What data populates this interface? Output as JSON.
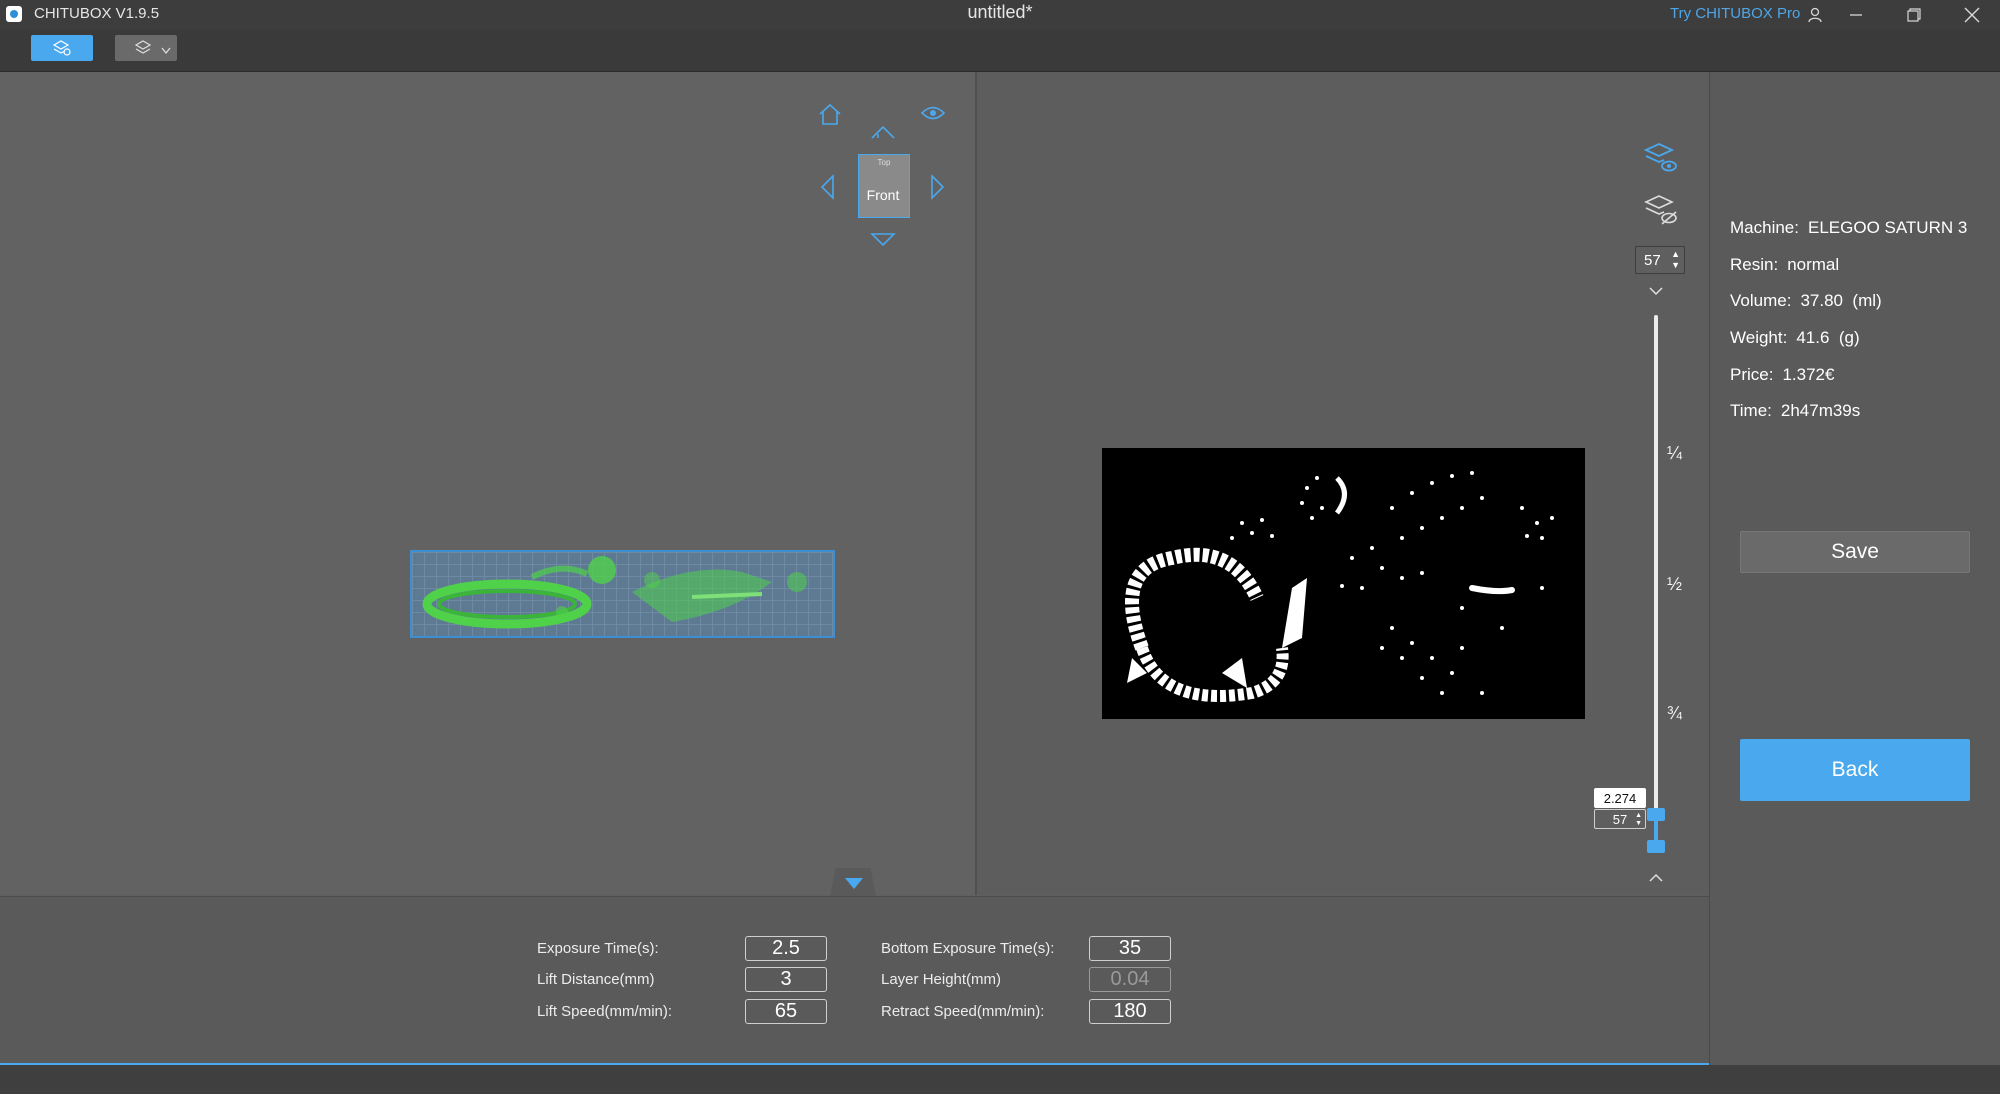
{
  "app": {
    "name": "CHITUBOX V1.9.5",
    "document_title": "untitled*",
    "try_pro_link": "Try CHITUBOX Pro"
  },
  "icons": {
    "app_logo": "app-logo-icon",
    "user": "user-icon",
    "minimize": "minimize-icon",
    "maximize": "restore-icon",
    "close": "close-icon",
    "slice_mode": "slice-layers-icon",
    "edit_mode": "edit-layers-icon",
    "home_view": "home-icon",
    "visibility": "eye-icon",
    "show_layers": "layers-eye-icon",
    "hide_layers": "layers-hidden-icon"
  },
  "view_cube": {
    "top_face": "Top",
    "front_face": "Front"
  },
  "layer_slider": {
    "top_layer": "57",
    "fractions": [
      "¼",
      "½",
      "¾"
    ],
    "current_height": "2.274",
    "current_layer": "57"
  },
  "parameters": {
    "left": [
      {
        "label": "Exposure Time(s):",
        "value": "2.5"
      },
      {
        "label": "Lift Distance(mm)",
        "value": "3"
      },
      {
        "label": "Lift Speed(mm/min):",
        "value": "65"
      }
    ],
    "right": [
      {
        "label": "Bottom Exposure Time(s):",
        "value": "35"
      },
      {
        "label": "Layer Height(mm)",
        "value": "0.04"
      },
      {
        "label": "Retract Speed(mm/min):",
        "value": "180"
      }
    ]
  },
  "info": [
    {
      "label": "Machine:",
      "value": "ELEGOO SATURN 3"
    },
    {
      "label": "Resin:",
      "value": "normal"
    },
    {
      "label": "Volume:",
      "value": "37.80  (ml)"
    },
    {
      "label": "Weight:",
      "value": "41.6  (g)"
    },
    {
      "label": "Price:",
      "value": "1.372€"
    },
    {
      "label": "Time:",
      "value": "2h47m39s"
    }
  ],
  "buttons": {
    "save": "Save",
    "back": "Back"
  },
  "colors": {
    "accent": "#4aa8ee",
    "model_green": "#4fd14a",
    "background": "#5f5f5f"
  }
}
